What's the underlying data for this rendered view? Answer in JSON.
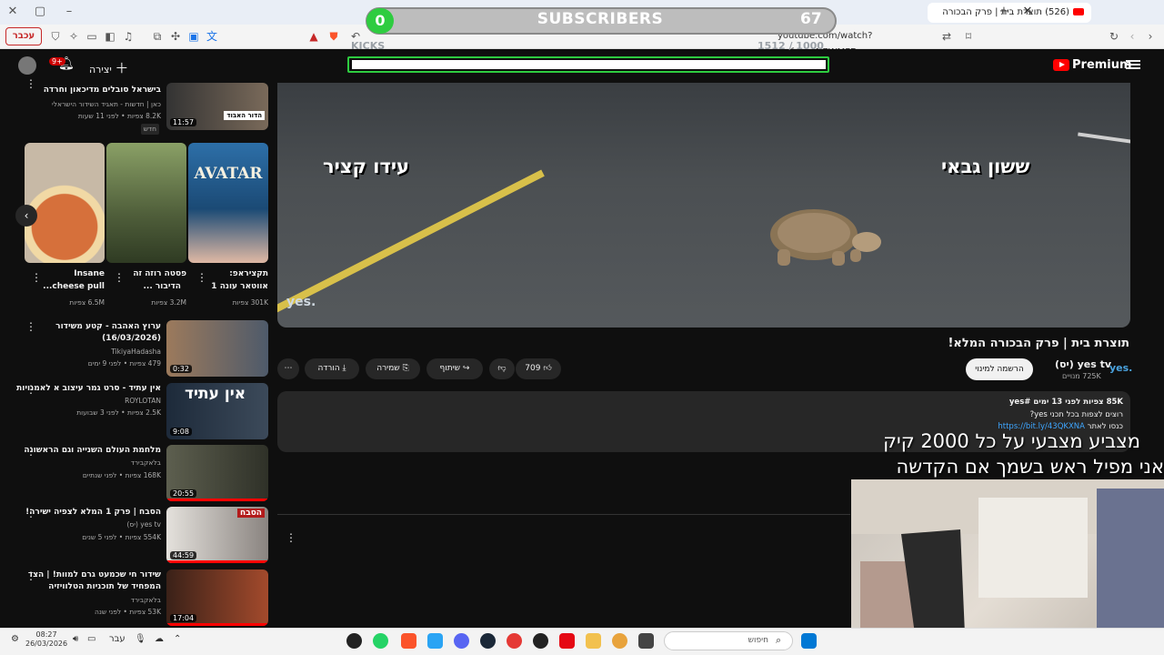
{
  "browser": {
    "tab_title": "(526) תוצרת בית | פרק הבכורה",
    "url": "youtube.com/watch?v=fzbo4NEWMFE",
    "reader_mode_label": "עכבר",
    "new_tab": "+",
    "close": "✕"
  },
  "overlay": {
    "sub_count": "0",
    "sub_label": "SUBSCRIBERS",
    "sub_goal": "67",
    "kicks_label": "KICKS",
    "kicks_count": "1512 / 1000"
  },
  "header": {
    "logo": "Premium",
    "create_label": "יצירה",
    "notif_badge": "9+"
  },
  "video": {
    "on_screen_left": "עידו קציר",
    "on_screen_right": "ששון גבאי",
    "watermark": "yes."
  },
  "info": {
    "title": "תוצרת בית | פרק הבכורה המלא!",
    "channel_logo": "yes.",
    "channel_name": "yes tv (יס)",
    "channel_subs": "725K מנויים",
    "subscribe_label": "הרשמה למינוי",
    "likes": "709",
    "share_label": "שיתוף",
    "save_label": "שמירה",
    "download_label": "הורדה",
    "more_label": "⋯"
  },
  "description": {
    "line1": "85K צפיות  לפני 13 ימים  #yes",
    "line2": "רוצים לצפות בכל תכני yes?",
    "line3_prefix": "כנסו לאתר ",
    "line3_link": "https://bit.ly/43QKXNA"
  },
  "captions": {
    "line1": "מצביע מצבעי על כל 2000 קיק",
    "line2": "אני מפיל ראש בשמך אם הקדשה"
  },
  "sidebar": {
    "top": {
      "title": "בישראל סובלים מדיכאון וחרדה",
      "channel": "כאן | חדשות - תאגיד השידור הישראלי",
      "meta": "8.2K צפיות • לפני 11 שעות",
      "badge": "חדש",
      "duration": "11:57",
      "thumb_text": "הדור האבוד"
    },
    "shorts": [
      {
        "title1": "תקציראפ:",
        "title2": "אווטאר עונה 1",
        "views": "301K צפיות",
        "thumb_text": "AVATAR"
      },
      {
        "title1": "פסטה רוזה זה",
        "title2": "הדיבור ...",
        "views": "3.2M צפיות"
      },
      {
        "title1": "Insane",
        "title2": "cheese pull...",
        "views": "6.5M צפיות"
      }
    ],
    "items": [
      {
        "title1": "ערוץ האהבה - קטע משידור",
        "title2": "(16/03/2026)",
        "channel": "TikiyaHadasha",
        "meta": "479 צפיות • לפני 9 ימים",
        "duration": "0:32"
      },
      {
        "title1": "אין עתיד - סרט גמר עיצוב א לאמנויות",
        "title2": "",
        "channel": "ROYLOTAN",
        "meta": "2.5K צפיות • לפני 3 שבועות",
        "duration": "9:08",
        "thumb_text": "אין עתיד"
      },
      {
        "title1": "מלחמת העולם השנייה וגם הראשונה",
        "title2": "",
        "channel": "בלאקבירד",
        "meta": "168K צפיות • לפני שנתיים",
        "duration": "20:55"
      },
      {
        "title1": "הסבח | פרק 1 המלא לצפיה ישירה!",
        "title2": "",
        "channel": "yes tv (יס)",
        "meta": "554K צפיות • לפני 5 שנים",
        "duration": "44:59",
        "thumb_text": "הסבח"
      },
      {
        "title1": "שידור חי שכמעט גרם למוות! | הצד",
        "title2": "המפחיד של תוכניות הטלוויזיה",
        "channel": "בלאקבירד",
        "meta": "53K צפיות • לפני שנה",
        "duration": "17:04"
      }
    ]
  },
  "taskbar": {
    "time": "08:27",
    "date": "26/03/2026",
    "lang": "עבר",
    "search_placeholder": "חיפוש"
  }
}
